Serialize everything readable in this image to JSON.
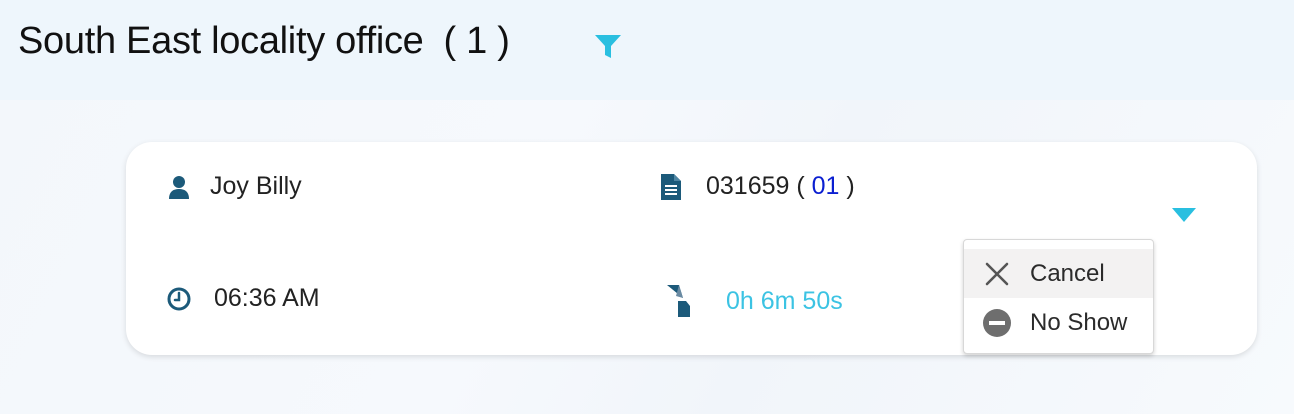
{
  "header": {
    "title": "South East locality office",
    "count": "( 1 )"
  },
  "icons": {
    "filter": "filter-icon",
    "person": "user-icon",
    "file": "document-icon",
    "clock": "clock-icon",
    "wait": "hourglass-icon",
    "menu_toggle": "caret-down-icon",
    "cancel": "close-icon",
    "no_show": "minus-circle-icon"
  },
  "colors": {
    "accent": "#3cc3e3",
    "icon_dark": "#1c5a7a",
    "link": "#0b1fd1"
  },
  "card": {
    "name": "Joy Billy",
    "file_number": "031659",
    "file_open": " ( ",
    "file_suffix": "01",
    "file_close": " )",
    "time": "06:36 AM",
    "wait_time": "0h 6m 50s"
  },
  "menu": {
    "items": [
      {
        "label": "Cancel"
      },
      {
        "label": "No Show"
      }
    ]
  }
}
